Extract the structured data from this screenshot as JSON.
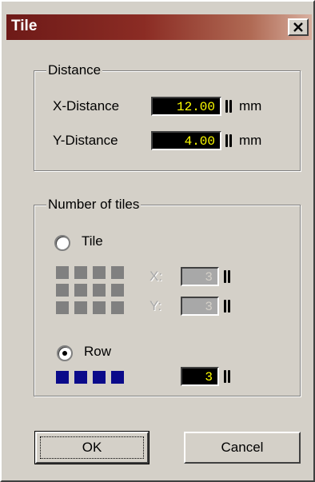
{
  "window": {
    "title": "Tile"
  },
  "distance": {
    "group_label": "Distance",
    "x_label": "X-Distance",
    "x_value": "12.00",
    "y_label": "Y-Distance",
    "y_value": "4.00",
    "unit": "mm"
  },
  "tiles": {
    "group_label": "Number of tiles",
    "tile_option_label": "Tile",
    "tile_selected": false,
    "x_label": "X:",
    "x_value": "3",
    "y_label": "Y:",
    "y_value": "3",
    "row_option_label": "Row",
    "row_selected": true,
    "row_value": "3"
  },
  "buttons": {
    "ok_label": "OK",
    "cancel_label": "Cancel"
  },
  "colors": {
    "field_bg": "#000000",
    "field_text": "#ffff00",
    "row_preview": "#0a0a8a",
    "tile_preview": "#808080"
  }
}
